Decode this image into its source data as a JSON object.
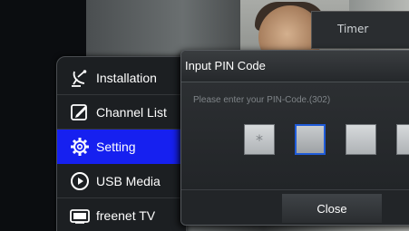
{
  "background": {
    "info_panel_text": "Timer"
  },
  "menu": {
    "items": [
      {
        "label": "Installation",
        "icon": "satellite-dish-icon",
        "active": false
      },
      {
        "label": "Channel List",
        "icon": "edit-list-icon",
        "active": false
      },
      {
        "label": "Setting",
        "icon": "gear-icon",
        "active": true
      },
      {
        "label": "USB Media",
        "icon": "play-circle-icon",
        "active": false
      },
      {
        "label": "freenet TV",
        "icon": "tv-icon",
        "active": false
      }
    ],
    "active_color": "#1620f0"
  },
  "dialog": {
    "title": "Input PIN Code",
    "prompt": "Please enter your PIN-Code.(302)",
    "pin_digits": [
      "*",
      "",
      "",
      ""
    ],
    "focused_index": 1,
    "close_label": "Close"
  }
}
